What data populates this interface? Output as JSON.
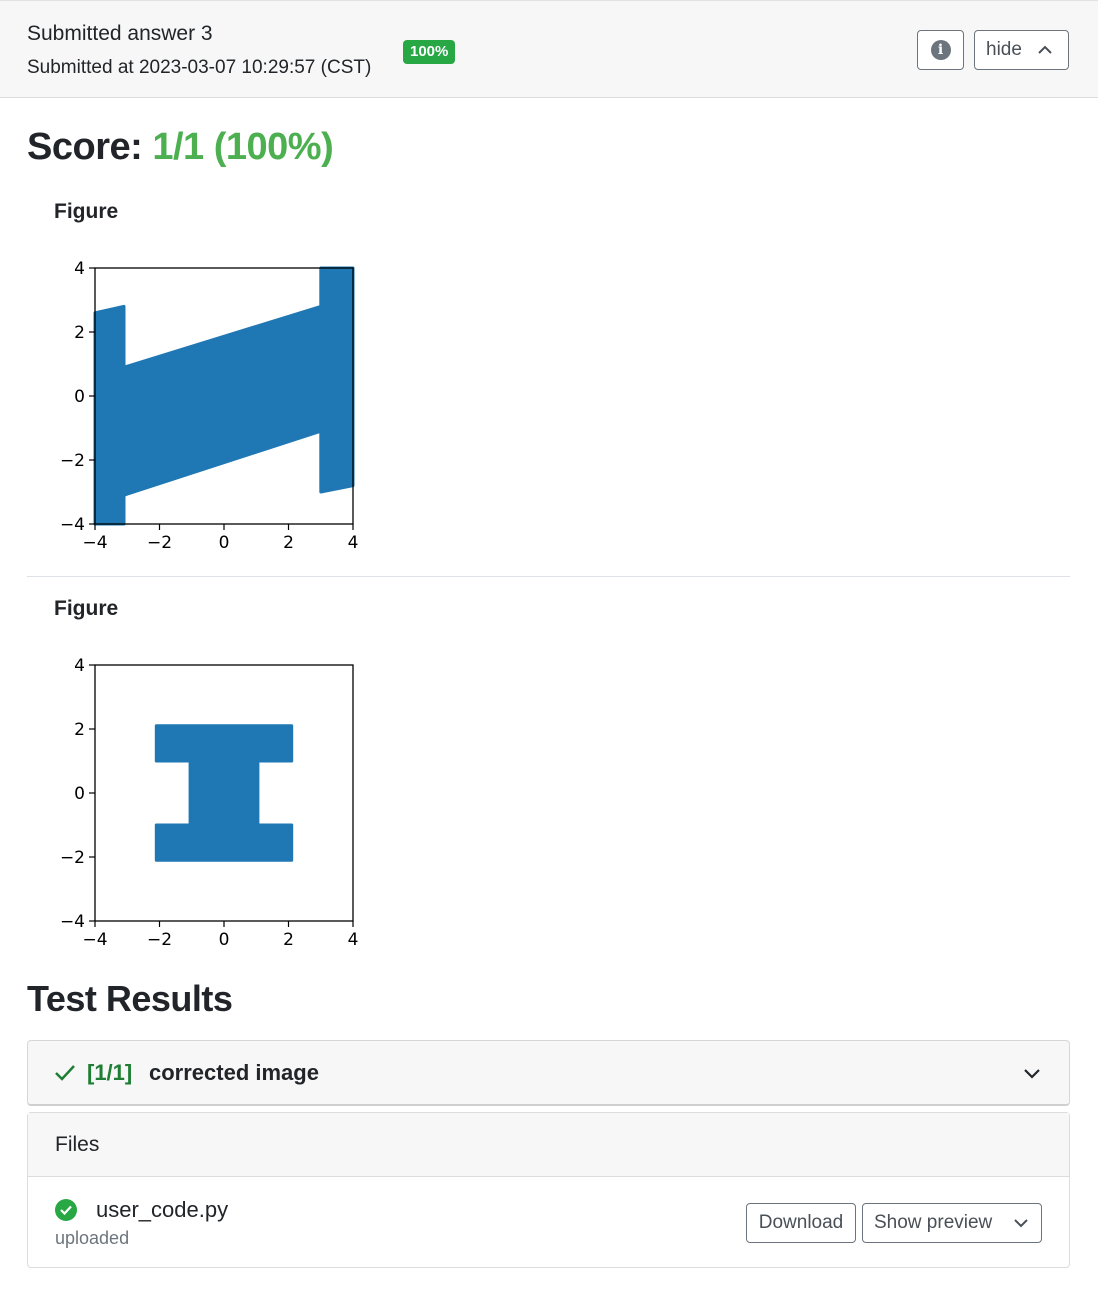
{
  "header": {
    "title": "Submitted answer 3",
    "submitted": "Submitted at 2023-03-07 10:29:57 (CST)",
    "badge": "100%",
    "hide_label": "hide",
    "info_icon": "info-icon",
    "chevron_icon": "chevron-up-icon"
  },
  "score": {
    "label": "Score:",
    "value": "1/1 (100%)",
    "color": "#4caf50"
  },
  "figures": [
    {
      "label": "Figure"
    },
    {
      "label": "Figure"
    }
  ],
  "chart_data": [
    {
      "type": "scatter",
      "title": "",
      "xlim": [
        -4,
        4
      ],
      "ylim": [
        -4,
        4
      ],
      "xticks": [
        "−4",
        "−2",
        "0",
        "2",
        "4"
      ],
      "yticks": [
        "4",
        "2",
        "0",
        "−2",
        "−4"
      ],
      "color": "#1f77b4",
      "shape": "sheared square with edges wrapped: upper band y from 0.2x+1.6 for x in [-3.1,3.0]; lower band y from 0.2x−2.4; wrapped columns at x in [-4,-3.1] and [3.0,4]",
      "polygon": [
        [
          -4.0,
          2.6
        ],
        [
          -3.1,
          2.8
        ],
        [
          -3.1,
          0.9
        ],
        [
          3.0,
          2.8
        ],
        [
          3.0,
          4.0
        ],
        [
          4.0,
          4.0
        ],
        [
          4.0,
          -2.8
        ],
        [
          3.0,
          -3.0
        ],
        [
          3.0,
          -1.1
        ],
        [
          -3.1,
          -3.1
        ],
        [
          -3.1,
          -4.0
        ],
        [
          -4.0,
          -4.0
        ]
      ]
    },
    {
      "type": "scatter",
      "title": "",
      "xlim": [
        -4,
        4
      ],
      "ylim": [
        -4,
        4
      ],
      "xticks": [
        "−4",
        "−2",
        "0",
        "2",
        "4"
      ],
      "yticks": [
        "4",
        "2",
        "0",
        "−2",
        "−4"
      ],
      "color": "#1f77b4",
      "shape": "I-beam",
      "polygon": [
        [
          -2.1,
          2.1
        ],
        [
          2.1,
          2.1
        ],
        [
          2.1,
          1.0
        ],
        [
          1.05,
          1.0
        ],
        [
          1.05,
          -1.0
        ],
        [
          2.1,
          -1.0
        ],
        [
          2.1,
          -2.1
        ],
        [
          -2.1,
          -2.1
        ],
        [
          -2.1,
          -1.0
        ],
        [
          -1.05,
          -1.0
        ],
        [
          -1.05,
          1.0
        ],
        [
          -2.1,
          1.0
        ]
      ]
    }
  ],
  "test_results": {
    "title": "Test Results",
    "items": [
      {
        "score": "[1/1]",
        "name": "corrected image",
        "status_icon": "check-icon",
        "expand_icon": "chevron-down-icon"
      }
    ]
  },
  "files": {
    "title": "Files",
    "items": [
      {
        "name": "user_code.py",
        "status": "uploaded",
        "status_icon": "check-circle-icon",
        "download_label": "Download",
        "preview_label": "Show preview"
      }
    ]
  }
}
